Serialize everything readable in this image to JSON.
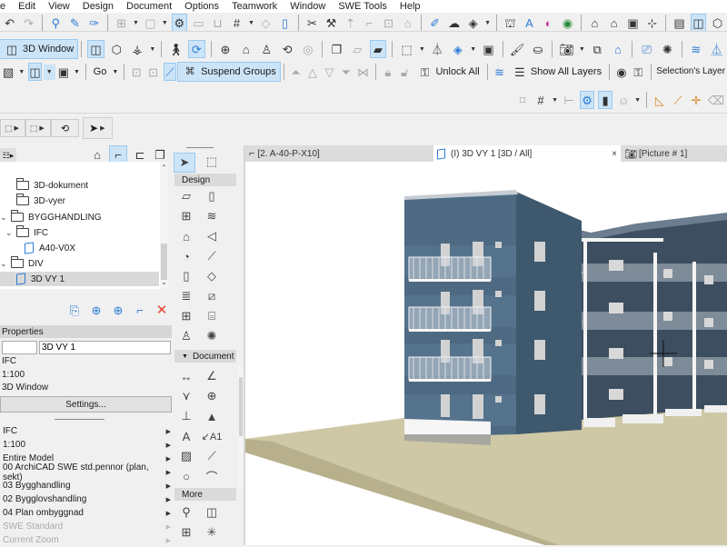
{
  "menubar": [
    "e",
    "Edit",
    "View",
    "Design",
    "Document",
    "Options",
    "Teamwork",
    "Window",
    "SWE Tools",
    "Help"
  ],
  "toolbar": {
    "window_3d_label": "3D Window",
    "go_label": "Go",
    "suspend_groups_label": "Suspend Groups",
    "unlock_all_label": "Unlock All",
    "show_all_layers_label": "Show All Layers",
    "selections_layer_label": "Selection's Layer"
  },
  "tabs": [
    {
      "label": "[2. A-40-P-X10]",
      "icon": "floor-plan-icon"
    },
    {
      "label": "(I) 3D VY 1 [3D / All]",
      "icon": "3d-view-icon",
      "close": "×"
    },
    {
      "label": "[Picture # 1]",
      "icon": "camera-icon"
    }
  ],
  "navigator": {
    "items": [
      {
        "label": "3D-dokument",
        "type": "folder",
        "level": 2
      },
      {
        "label": "3D-vyer",
        "type": "folder",
        "level": 2
      },
      {
        "label": "BYGGHANDLING",
        "type": "folder",
        "level": 1,
        "expanded": true
      },
      {
        "label": "IFC",
        "type": "folder",
        "level": 2,
        "expanded": true
      },
      {
        "label": "A40-V0X",
        "type": "view",
        "level": 3
      },
      {
        "label": "DIV",
        "type": "folder",
        "level": 1,
        "expanded": true
      },
      {
        "label": "3D VY 1",
        "type": "view",
        "level": 2,
        "selected": true
      }
    ]
  },
  "properties": {
    "title": "Properties",
    "id_value": "",
    "name_value": "3D VY 1",
    "rows": [
      "IFC",
      "1:100",
      "3D Window"
    ],
    "settings_label": "Settings..."
  },
  "quick_options": [
    {
      "label": "IFC",
      "enabled": true
    },
    {
      "label": "1:100",
      "enabled": true
    },
    {
      "label": "Entire Model",
      "enabled": true
    },
    {
      "label": "00 ArchiCAD SWE std.pennor (plan, sekt)",
      "enabled": true
    },
    {
      "label": "03 Bygghandling",
      "enabled": true
    },
    {
      "label": "02 Bygglovshandling",
      "enabled": true
    },
    {
      "label": "04 Plan ombyggnad",
      "enabled": true
    },
    {
      "label": "SWE Standard",
      "enabled": false
    },
    {
      "label": "Current Zoom",
      "enabled": false
    }
  ],
  "toolbox": {
    "design_label": "Design",
    "document_label": "Document",
    "more_label": "More"
  },
  "colors": {
    "selection": "#cce4f7",
    "facade": "#4d6a82",
    "ground": "#cfc8a6",
    "delete": "#e8412f",
    "accent": "#2b7bd6"
  }
}
